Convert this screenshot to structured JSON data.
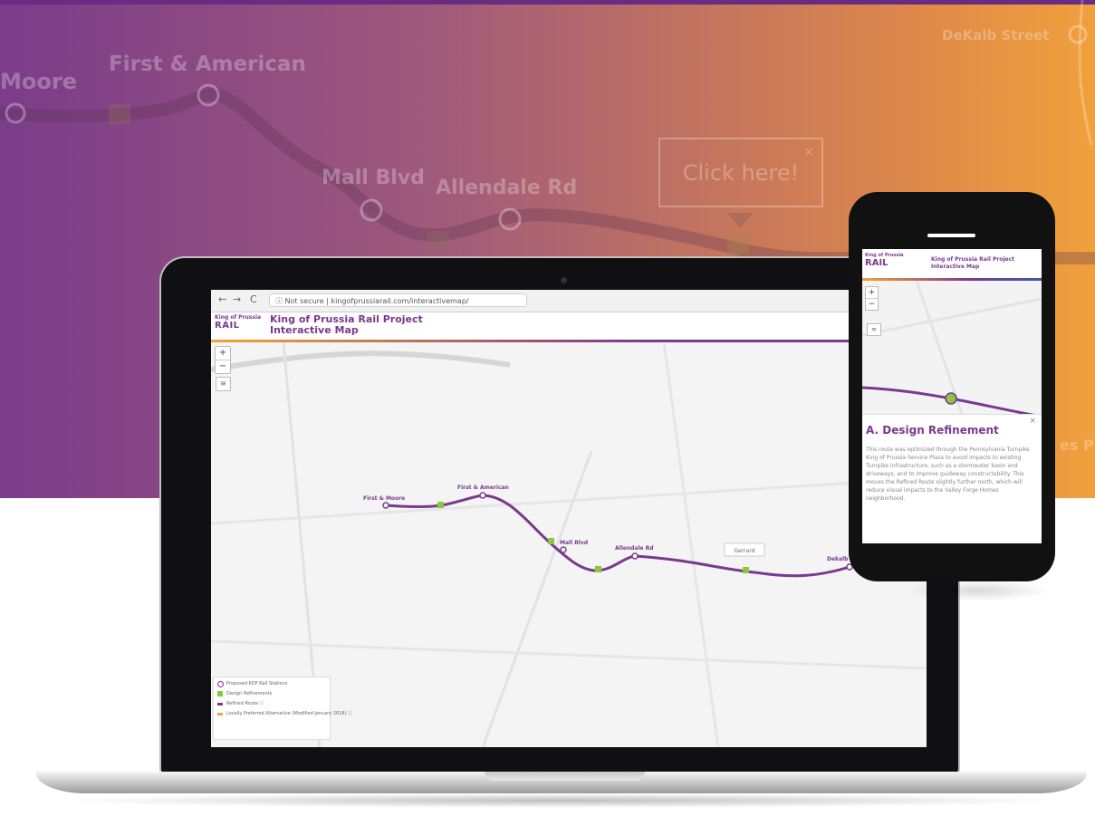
{
  "banner": {
    "stations": [
      {
        "label": "Moore"
      },
      {
        "label": "First & American"
      },
      {
        "label": "Mall Blvd"
      },
      {
        "label": "Allendale Rd"
      },
      {
        "label": "DeKalb Street"
      },
      {
        "label": "es P"
      }
    ],
    "callout": {
      "label": "Click here!",
      "close": "×"
    }
  },
  "laptop": {
    "browser": {
      "back": "←",
      "forward": "→",
      "reload": "C",
      "url": "ⓘ Not secure | kingofprussiarail.com/interactivemap/"
    },
    "app": {
      "logo_top": "King of Prussia",
      "logo_main": "RAIL",
      "title_line1": "King of Prussia Rail Project",
      "title_line2": "Interactive Map"
    },
    "controls": {
      "zoom_in": "+",
      "zoom_out": "−",
      "layers": "≋"
    },
    "map_labels": [
      "First & Moore",
      "First & American",
      "Mall Blvd",
      "Allendale Rd",
      "Dekalb"
    ],
    "map_callout": "Gerrard",
    "legend": [
      "Proposed KOP Rail Stations",
      "Design Refinements",
      "Refined Route ⓘ",
      "Locally Preferred Alternative (Modified January 2018) ⓘ"
    ]
  },
  "phone": {
    "logo_top": "King of Prussia",
    "logo_main": "RAIL",
    "title_line1": "King of Prussia Rail Project",
    "title_line2": "Interactive Map",
    "controls": {
      "zoom_in": "+",
      "zoom_out": "−",
      "layers": "≋"
    },
    "panel": {
      "close": "×",
      "title": "A. Design Refinement",
      "body": "This route was optimized through the Pennsylvania Turnpike King of Prussia Service Plaza to avoid impacts to existing Turnpike infrastructure, such as a stormwater basin and driveways, and to improve guideway constructability. This moves the Refined Route slightly further north, which will reduce visual impacts to the Valley Forge Homes neighborhood."
    }
  },
  "colors": {
    "route": "#7a3a8c",
    "station_fill": "#ffffff",
    "refinement_marker": "#8cc63f",
    "banner_start": "#7b3c8a",
    "banner_end": "#f0a13c"
  }
}
